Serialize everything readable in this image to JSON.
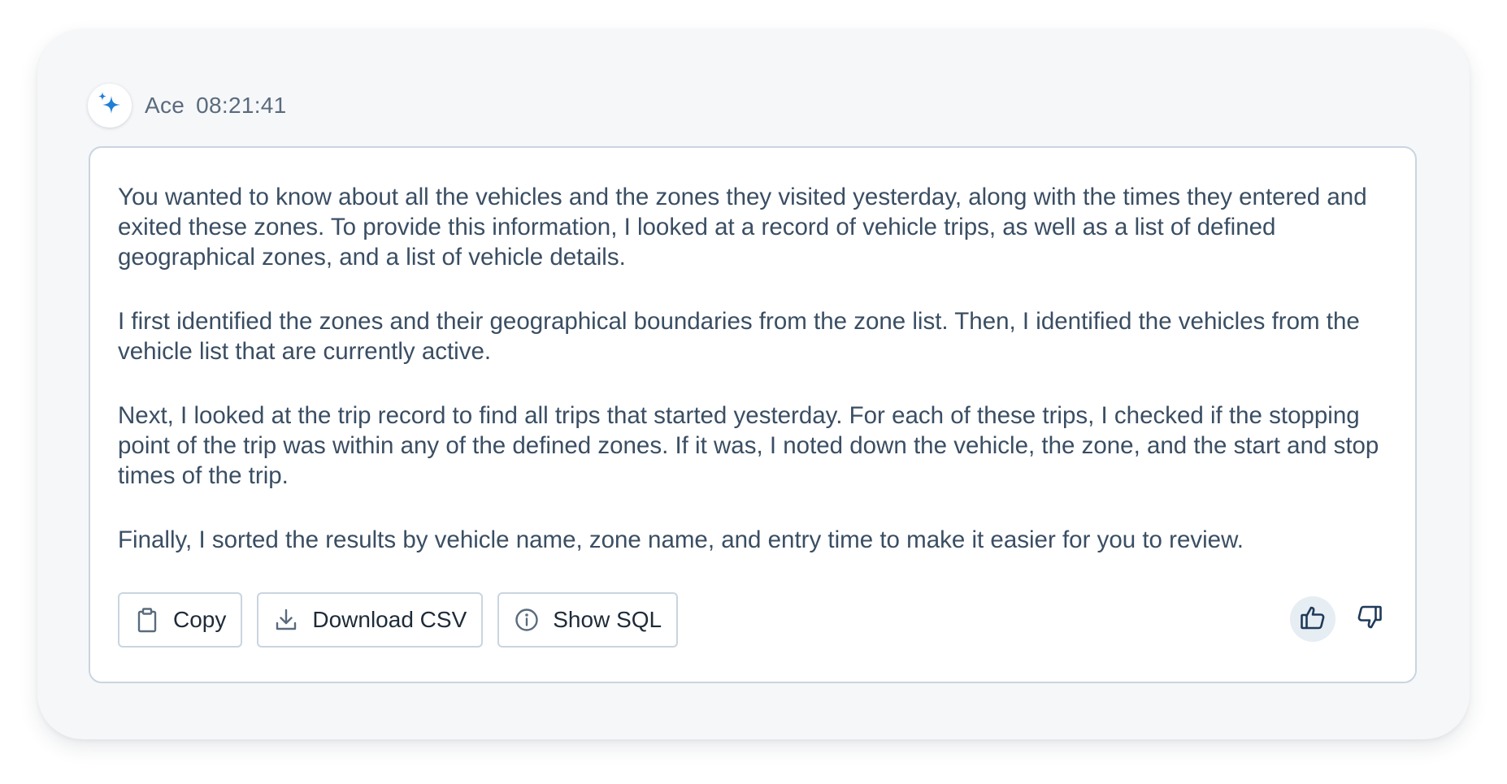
{
  "header": {
    "sender": "Ace",
    "time": "08:21:41",
    "avatar_icon": "sparkle-icon",
    "avatar_color": "#1f7fd6"
  },
  "message": {
    "paragraphs": [
      "You wanted to know about all the vehicles and the zones they visited yesterday, along with the times they entered and exited these zones. To provide this information, I looked at a record of vehicle trips, as well as a list of defined geographical zones, and a list of vehicle details.",
      "I first identified the zones and their geographical boundaries from the zone list. Then, I identified the vehicles from the vehicle list that are currently active.",
      "Next, I looked at the trip record to find all trips that started yesterday. For each of these trips, I checked if the stopping point of the trip was within any of the defined zones. If it was, I noted down the vehicle, the zone, and the start and stop times of the trip.",
      "Finally, I sorted the results by vehicle name, zone name, and entry time to make it easier for you to review."
    ]
  },
  "actions": {
    "copy_label": "Copy",
    "copy_icon": "clipboard-icon",
    "download_label": "Download CSV",
    "download_icon": "download-icon",
    "sql_label": "Show SQL",
    "sql_icon": "info-icon"
  },
  "feedback": {
    "like_icon": "thumbs-up-icon",
    "dislike_icon": "thumbs-down-icon",
    "like_active": true,
    "icon_color": "#1f3a5a"
  }
}
